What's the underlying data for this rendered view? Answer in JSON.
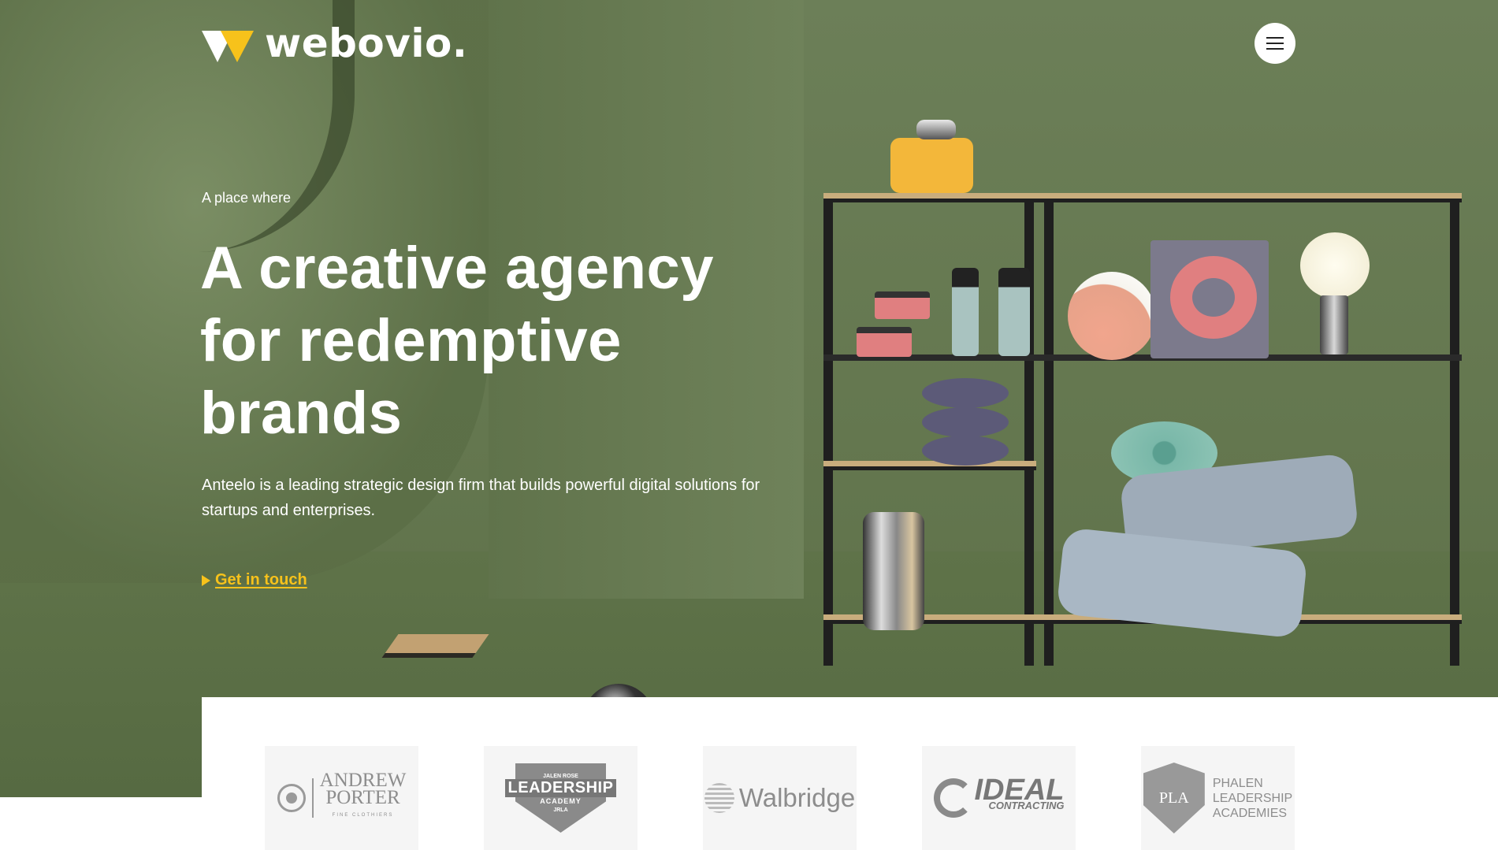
{
  "header": {
    "logo_text": "webovio.",
    "logo_icon": "w-logo-mark",
    "menu_icon": "hamburger-icon"
  },
  "hero": {
    "eyebrow": "A place where",
    "headline_lines": [
      "A creative agency",
      "for redemptive",
      "brands"
    ],
    "lead": "Anteelo is a leading strategic design firm that builds powerful digital solutions for startups and enterprises.",
    "cta_label": "Get in touch",
    "cta_icon": "play-triangle-icon"
  },
  "clients": {
    "logos": [
      {
        "line1": "ANDREW",
        "line2": "PORTER",
        "sub": "FINE CLOTHIERS"
      },
      {
        "top": "JALEN ROSE",
        "main": "LEADERSHIP",
        "sub": "ACADEMY",
        "badge": "JRLA"
      },
      {
        "main": "Walbridge"
      },
      {
        "main": "IDEAL",
        "sub": "CONTRACTING"
      },
      {
        "line1": "PHALEN",
        "line2": "LEADERSHIP",
        "line3": "ACADEMIES",
        "crest": "PLA"
      }
    ]
  },
  "colors": {
    "accent": "#f7c21b",
    "hero_green": "#64774f",
    "text_light": "#ffffff"
  }
}
